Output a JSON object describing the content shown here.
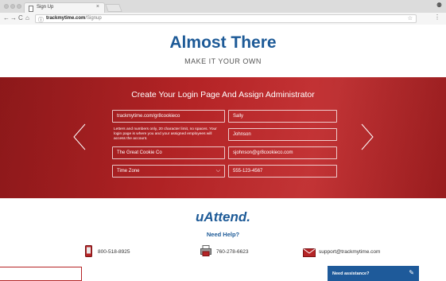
{
  "browser": {
    "tab_title": "Sign Up",
    "tab_close": "×",
    "url_host": "trackmytime.com",
    "url_path": "/Signup",
    "back_glyph": "←",
    "forward_glyph": "→",
    "reload_glyph": "C",
    "home_glyph": "⌂",
    "info_glyph": "ⓘ",
    "star_glyph": "☆",
    "menu_glyph": "⋮",
    "profile_glyph": "⚉"
  },
  "header": {
    "title": "Almost There",
    "subtitle": "MAKE IT YOUR OWN"
  },
  "form": {
    "title": "Create Your Login Page And Assign Administrator",
    "login_url_value": "trackmytime.com/gr8cookieco",
    "login_hint": "Letters and numbers only, 20 character limit, no spaces. Your login page is where you and your assigned employees will access the account.",
    "company_value": "The Great Cookie Co",
    "timezone_value": "Time Zone",
    "timezone_caret": "⌵",
    "first_name_value": "Sally",
    "last_name_value": "Johnson",
    "email_value": "sjohnson@gr8cookieco.com",
    "phone_value": "555-123-4567"
  },
  "footer": {
    "logo": "uAttend.",
    "need_help": "Need Help?",
    "phone_1": "800-518-8925",
    "phone_2": "760-278-6623",
    "email": "support@trackmytime.com"
  },
  "chat": {
    "label": "Need assistance?",
    "icon_glyph": "✎"
  },
  "colors": {
    "brand_blue": "#1d5a97",
    "band_red": "#b52426",
    "chat_blue": "#1e5a9a"
  }
}
